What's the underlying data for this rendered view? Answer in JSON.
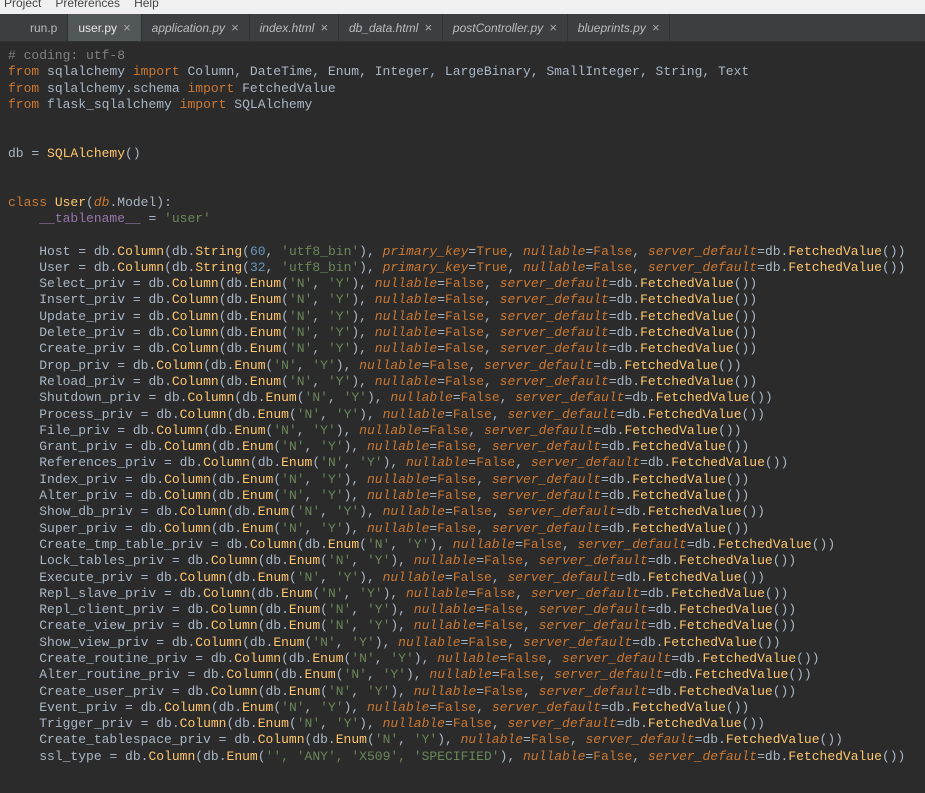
{
  "menubar": {
    "items": [
      "Project",
      "Preferences",
      "Help"
    ]
  },
  "tabs": [
    {
      "label": "run.p",
      "close": false,
      "style": "truncated"
    },
    {
      "label": "user.py",
      "close": true,
      "style": "active"
    },
    {
      "label": "application.py",
      "close": true,
      "style": "inactive"
    },
    {
      "label": "index.html",
      "close": true,
      "style": "inactive"
    },
    {
      "label": "db_data.html",
      "close": true,
      "style": "inactive"
    },
    {
      "label": "postController.py",
      "close": true,
      "style": "inactive"
    },
    {
      "label": "blueprints.py",
      "close": true,
      "style": "inactive"
    }
  ],
  "code": {
    "l00": "# coding: utf-8",
    "kw_from": "from",
    "kw_import": "import",
    "kw_class": "class",
    "mod1": "sqlalchemy",
    "imp1": "Column, DateTime, Enum, Integer, LargeBinary, SmallInteger, String, Text",
    "mod2": "sqlalchemy.schema",
    "imp2": "FetchedValue",
    "mod3": "flask_sqlalchemy",
    "imp3": "SQLAlchemy",
    "dbassign": "db = ",
    "sqlalchemy_call": "SQLAlchemy",
    "class_user": "User",
    "db_model": "db",
    "model_attr": "Model",
    "tablename_attr": "__tablename__",
    "tablename_val": "'user'",
    "col": "Column",
    "string": "String",
    "enum": "Enum",
    "fetched": "FetchedValue",
    "n60": "60",
    "n32": "32",
    "utf8bin": "'utf8_bin'",
    "strN": "'N'",
    "strY": "'Y'",
    "primary_key": "primary_key",
    "nullable": "nullable",
    "server_default": "server_default",
    "true": "True",
    "false": "False",
    "db": "db",
    "attrs": {
      "host": "Host",
      "user": "User",
      "select_priv": "Select_priv",
      "insert_priv": "Insert_priv",
      "update_priv": "Update_priv",
      "delete_priv": "Delete_priv",
      "create_priv": "Create_priv",
      "drop_priv": "Drop_priv",
      "reload_priv": "Reload_priv",
      "shutdown_priv": "Shutdown_priv",
      "process_priv": "Process_priv",
      "file_priv": "File_priv",
      "grant_priv": "Grant_priv",
      "references_priv": "References_priv",
      "index_priv": "Index_priv",
      "alter_priv": "Alter_priv",
      "show_db_priv": "Show_db_priv",
      "super_priv": "Super_priv",
      "create_tmp_table_priv": "Create_tmp_table_priv",
      "lock_tables_priv": "Lock_tables_priv",
      "execute_priv": "Execute_priv",
      "repl_slave_priv": "Repl_slave_priv",
      "repl_client_priv": "Repl_client_priv",
      "create_view_priv": "Create_view_priv",
      "show_view_priv": "Show_view_priv",
      "create_routine_priv": "Create_routine_priv",
      "alter_routine_priv": "Alter_routine_priv",
      "create_user_priv": "Create_user_priv",
      "event_priv": "Event_priv",
      "trigger_priv": "Trigger_priv",
      "create_tablespace_priv": "Create_tablespace_priv",
      "ssl_type": "ssl_type"
    },
    "ssl_enum_vals": "'', 'ANY', 'X509', 'SPECIFIED'"
  }
}
